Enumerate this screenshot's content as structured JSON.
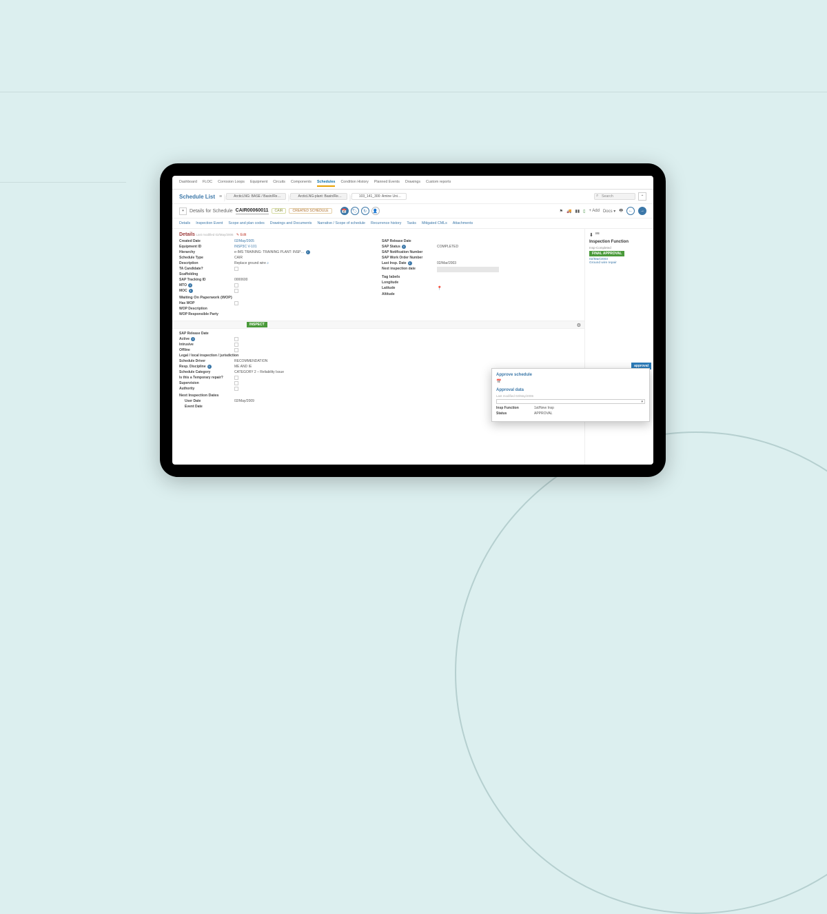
{
  "nav": {
    "items": [
      "Dashboard",
      "FLOC",
      "Corrosion Loops",
      "Equipment",
      "Circuits",
      "Components",
      "Schedules",
      "Condition History",
      "Planned Events",
      "Drawings",
      "Custom reports"
    ],
    "active": "Schedules"
  },
  "listTitle": "Schedule List",
  "breadcrumbs": [
    "ArcticLNG: BASE / Basin/Re…",
    "ArcticLNG-plant: Basin/Re…",
    "103_141_300: Amine Uni…"
  ],
  "search": {
    "placeholder": "Search"
  },
  "collapseGlyph": "⌃",
  "header": {
    "plus": "+",
    "detailsFor": "Details for Schedule",
    "scheduleId": "CAIR00060011",
    "tags": [
      "CAIR",
      "CREATED SCHEDULE"
    ],
    "right": {
      "addLabel": "+ Add",
      "docsLabel": "Docs ▾"
    }
  },
  "subtabs": [
    "Details",
    "Inspection Event",
    "Scope and plan codes",
    "Drawings and Documents",
    "Narrative / Scope of schedule",
    "Recurrence history",
    "Tasks",
    "Mitigated CMLs",
    "Attachments"
  ],
  "detailsHeading": "Details",
  "detailsSub": "Last modified 02/May/2006",
  "editLabel": "Edit",
  "left": {
    "createdDateL": "Created Date",
    "createdDate": "02/May/2005",
    "equipIdL": "Equipment ID",
    "equipId": "INSP3C V-101",
    "hierarchyL": "Hierarchy",
    "hierarchy": "e-IMS TRAINING: TRAINING PLANT: INSP…",
    "schedTypeL": "Schedule Type",
    "schedType": "CAIR",
    "descL": "Description",
    "desc": "Replace ground wire",
    "taL": "TA Candidate?",
    "scafL": "Scaffolding",
    "sapTrackL": "SAP Tracking ID",
    "sapTrack": "0000600",
    "mtoL": "MTO",
    "mocL": "MOC",
    "wopH": "Waiting On Paperwork (WOP)",
    "hasWopL": "Has WOP",
    "wopDescL": "WOP Description",
    "wopRespL": "WOP Responsible Party"
  },
  "right": {
    "sapRelL": "SAP Release Date",
    "sapStatL": "SAP Status",
    "sapStat": "COMPLETED",
    "sapNotifL": "SAP Notification Number",
    "sapWoL": "SAP Work Order Number",
    "lastInspL": "Last Insp. Date",
    "lastInsp": "02/Mar/2003",
    "nextInspL": "Next inspection date",
    "tagH": "Tag labels",
    "longL": "Longitude",
    "latL": "Latitude",
    "altL": "Altitude"
  },
  "inspectBadge": "INSPECT",
  "lower": {
    "sapRelL": "SAP Release Date",
    "activeL": "Active",
    "intrusiveL": "Intrusive",
    "offlineL": "Offline",
    "legalL": "Legal / local inspection / jurisdiction",
    "driverL": "Schedule Driver",
    "driver": "RECOMMENDATION",
    "respDiscL": "Resp. Discipline",
    "respDisc": "ME AND IE",
    "catL": "Schedule Category",
    "cat": "CATEGORY 2 – Reliability Issue",
    "tempL": "Is this a Temporary repair?",
    "supL": "Supervision",
    "authL": "Authority",
    "nidH": "Next Inspection Dates",
    "userDateL": "User Date",
    "userDate": "02/May/2009",
    "eventDateL": "Event Date"
  },
  "side": {
    "heading": "Inspection Function",
    "status": "Insp-Completed",
    "badge": "FINAL APPROVAL",
    "date": "02/Mar/2003",
    "link": "Ground wire repair"
  },
  "approveBtn": "approval",
  "popup": {
    "h1": "Approve schedule",
    "h2": "Approval data",
    "sub": "Last modified 02/May/2006",
    "inspFuncL": "Insp Function",
    "inspFunc": "1st/New Insp",
    "statusL": "Status",
    "status": "APPROVAL"
  }
}
